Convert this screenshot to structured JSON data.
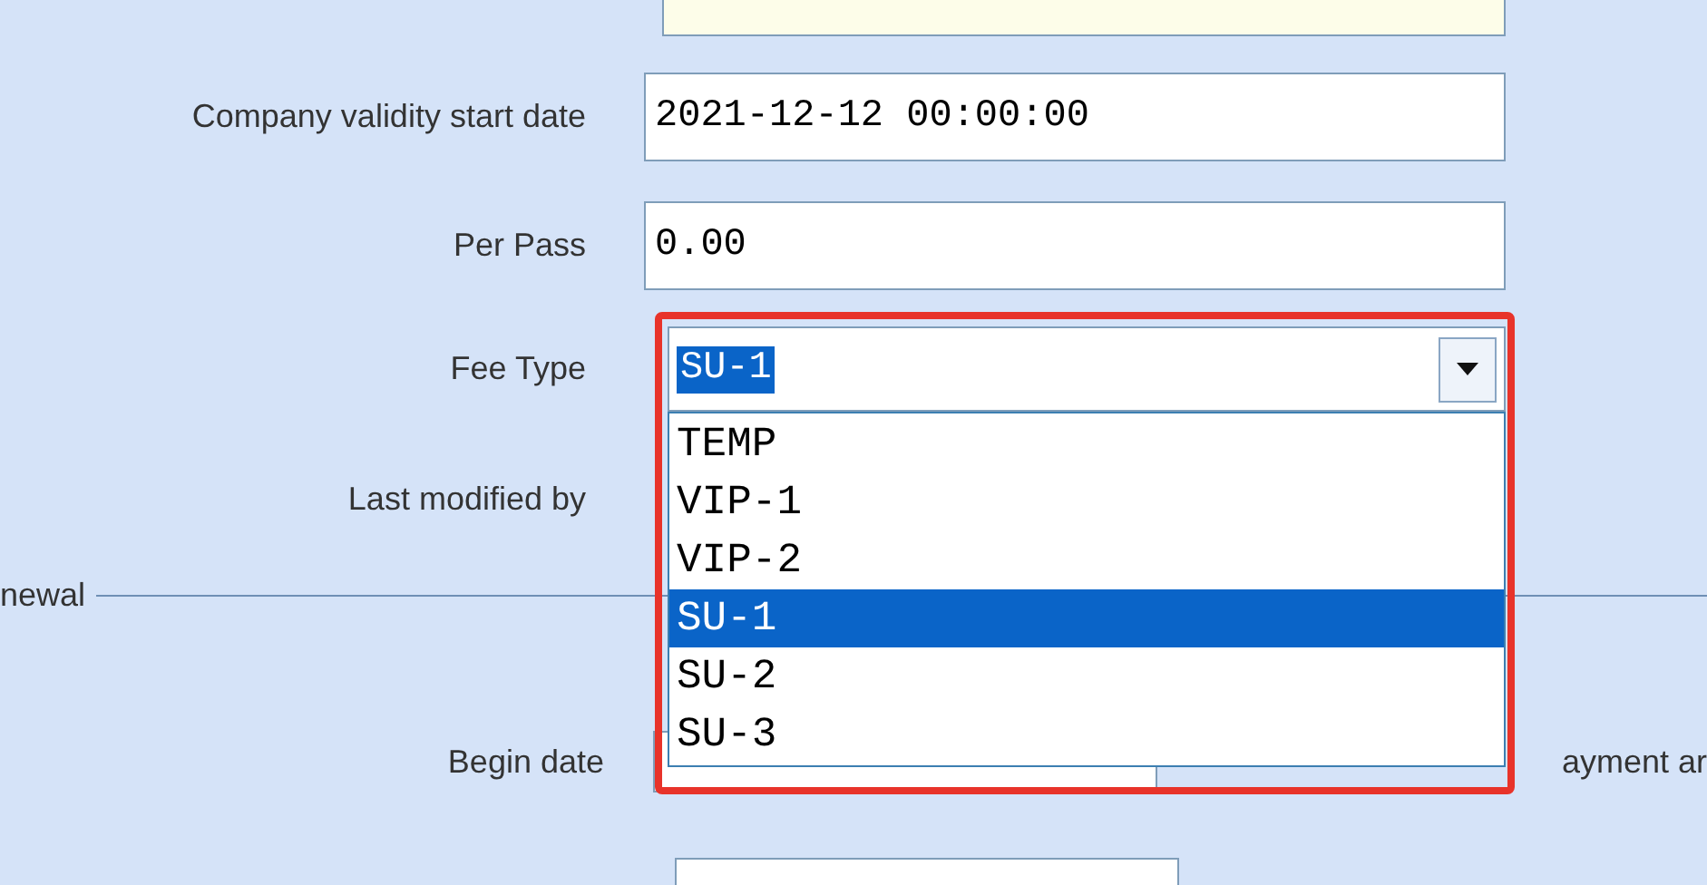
{
  "fields": [
    {
      "label": "Company validity start date",
      "value": "2021-12-12 00:00:00"
    },
    {
      "label": "Per Pass",
      "value": "0.00"
    }
  ],
  "fee_type": {
    "label": "Fee Type",
    "value": "SU-1",
    "expanded": true,
    "options": [
      {
        "label": "TEMP",
        "selected": false
      },
      {
        "label": "VIP-1",
        "selected": false
      },
      {
        "label": "VIP-2",
        "selected": false
      },
      {
        "label": "SU-1",
        "selected": true
      },
      {
        "label": "SU-2",
        "selected": false
      },
      {
        "label": "SU-3",
        "selected": false
      }
    ]
  },
  "last_modified_by": {
    "label": "Last modified by"
  },
  "renewal_group": {
    "title": "newal",
    "begin_date": {
      "label": "Begin date"
    },
    "payment_label": "ayment ar"
  }
}
